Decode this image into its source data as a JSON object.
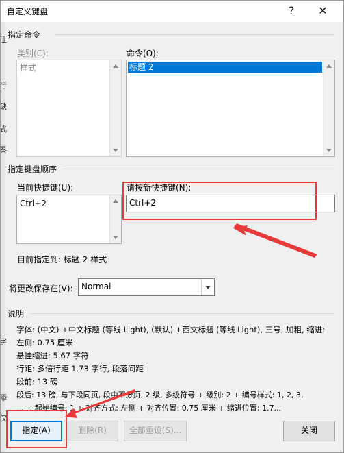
{
  "window": {
    "title": "自定义键盘",
    "help_icon": "question-mark-icon",
    "close_icon": "close-icon"
  },
  "assign": {
    "section_label": "指定命令",
    "category_label": "类别(C):",
    "category_items": [
      "样式"
    ],
    "commands_label": "命令(O):",
    "commands_items": [
      "标题 2"
    ]
  },
  "keyseq": {
    "section_label": "指定键盘顺序",
    "current_keys_label": "当前快捷键(U):",
    "current_keys": [
      "Ctrl+2"
    ],
    "new_key_label": "请按新快捷键(N):",
    "new_key_value": "Ctrl+2"
  },
  "assigned_to": "目前指定到:  标题 2 样式",
  "save_in": {
    "label": "将更改保存在(V):",
    "value": "Normal"
  },
  "description": {
    "section_label": "说明",
    "lines": [
      "字体: (中文) +中文标题 (等线 Light), (默认) +西文标题 (等线 Light), 三号, 加粗, 缩进:",
      "    左侧:  0.75 厘米",
      "    悬挂缩进: 5.67 字符",
      "    行距: 多倍行距 1.73 字行, 段落间距",
      "    段前: 13 磅",
      "    段后: 13 磅, 与下段同页, 段中不分页, 2 级, 多级符号 + 级别: 2 + 编号样式: 1, 2, 3,",
      "... + 起始编号: 1 + 对齐方式: 左侧 + 对齐位置:  0.75 厘米 + 缩进位置:  1.7..."
    ]
  },
  "buttons": {
    "assign": "指定(A)",
    "remove": "删除(R)",
    "reset_all": "全部重设(S)...",
    "close": "关闭"
  },
  "colors": {
    "selection": "#0078d7",
    "annotation_red": "#e83a3a"
  },
  "background_edge_chars": [
    "往",
    "行",
    "缺",
    "式",
    "奏",
    "字",
    "添",
    "仅"
  ]
}
